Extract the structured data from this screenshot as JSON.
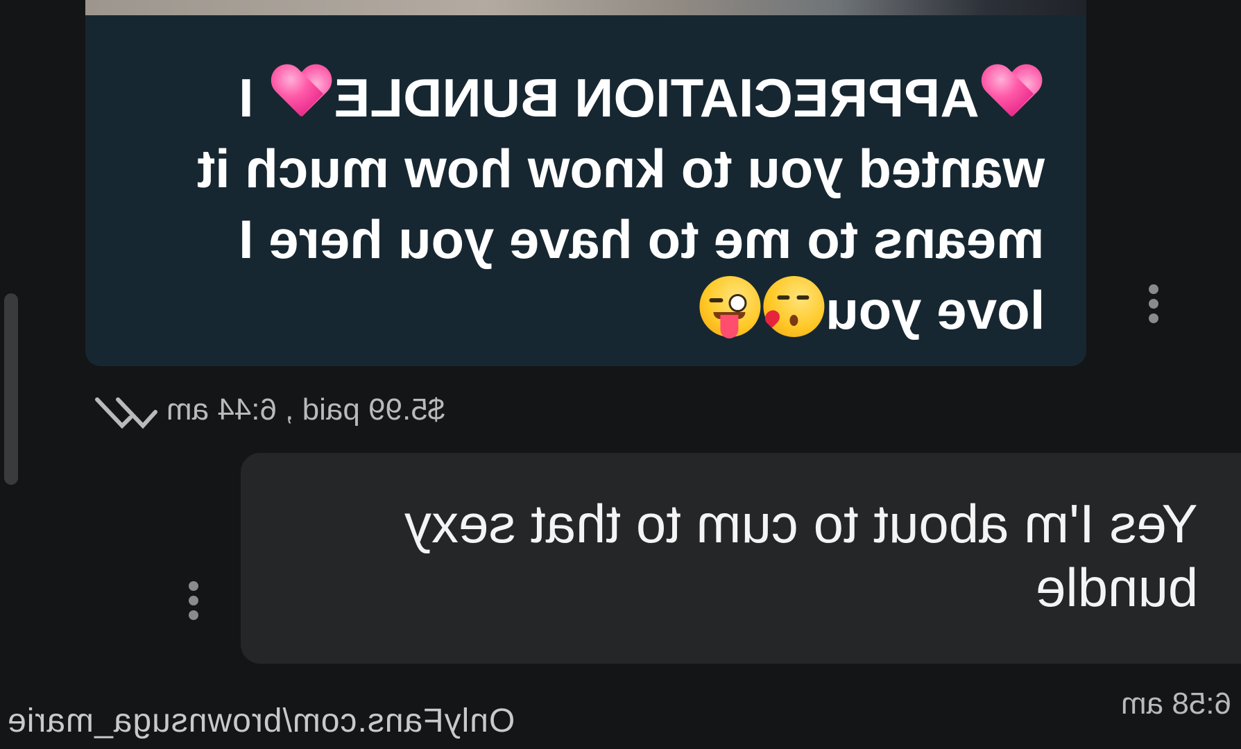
{
  "incoming_message": {
    "lines": [
      {
        "pre_icon": "pink-heart-emoji",
        "text": "APPRECIATION BUNDLE",
        "post_icon": "pink-heart-emoji",
        "tail": " I"
      },
      {
        "text": "wanted you to know how much it"
      },
      {
        "text": "means to me to have you here I"
      },
      {
        "text": "love you",
        "icons": [
          "kissing-face-emoji",
          "winking-tongue-face-emoji"
        ]
      }
    ],
    "price_status": "$5.99 paid , 6:44 am",
    "read_icon": "double-check-icon",
    "bubble_color": "#172731"
  },
  "outgoing_message": {
    "lines": [
      "Yes I'm about to cum to that sexy",
      "bundle"
    ],
    "time": "6:58 am",
    "bubble_color": "#252628"
  },
  "watermark": "OnlyFans.com/brownsuga_marie",
  "colors": {
    "background": "#141516",
    "text_primary": "#ffffff",
    "text_meta": "#b9babc"
  },
  "mirrored": true
}
